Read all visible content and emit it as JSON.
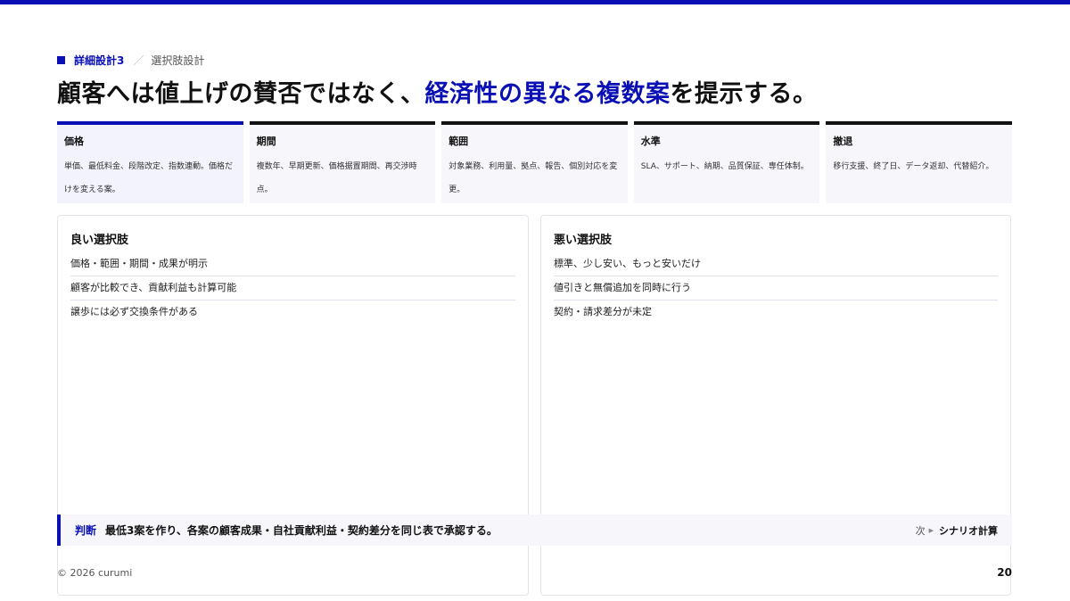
{
  "eyebrow": {
    "section": "詳細設計3",
    "subtitle": "選択肢設計"
  },
  "headline": {
    "before": "顧客へは値上げの賛否ではなく、",
    "accent": "経済性の異なる複数案",
    "after": "を提示する。"
  },
  "categories": [
    {
      "title": "価格",
      "desc": "単価、最低料金、段階改定、指数連動。価格だけを変える案。"
    },
    {
      "title": "期間",
      "desc": "複数年、早期更新、価格据置期間、再交渉時点。"
    },
    {
      "title": "範囲",
      "desc": "対象業務、利用量、拠点、報告、個別対応を変更。"
    },
    {
      "title": "水準",
      "desc": "SLA、サポート、納期、品質保証、専任体制。"
    },
    {
      "title": "撤退",
      "desc": "移行支援、終了日、データ返却、代替紹介。"
    }
  ],
  "good": {
    "title": "良い選択肢",
    "items": [
      "価格・範囲・期間・成果が明示",
      "顧客が比較でき、貢献利益も計算可能",
      "譲歩には必ず交換条件がある"
    ]
  },
  "bad": {
    "title": "悪い選択肢",
    "items": [
      "標準、少し安い、もっと安いだけ",
      "値引きと無償追加を同時に行う",
      "契約・請求差分が未定"
    ]
  },
  "decision": {
    "label": "判断",
    "text": "最低3案を作り、各案の顧客成果・自社貢献利益・契約差分を同じ表で承認する。",
    "next_label": "次",
    "next_target": "シナリオ計算"
  },
  "footer": {
    "copyright": "© 2026 curumi",
    "page": "20"
  },
  "colors": {
    "accent": "#0a10b4",
    "ink": "#111111",
    "card_bg": "#f6f6fb"
  }
}
